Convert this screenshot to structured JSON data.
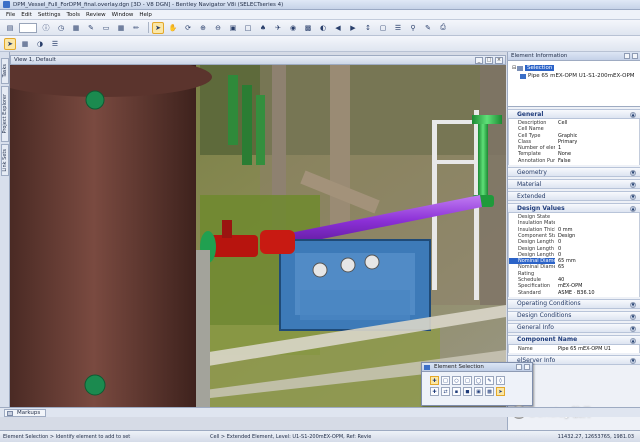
{
  "window": {
    "title": "DPM_Vessel_Full_ForDPM_final.overlay.dgn [3D - V8 DGN] - Bentley Navigator V8i (SELECTseries 4)"
  },
  "menu": [
    "File",
    "Edit",
    "Settings",
    "Tools",
    "Review",
    "Window",
    "Help"
  ],
  "left_tabs": [
    "Tasks",
    "Project Explorer",
    "Link Sets"
  ],
  "view": {
    "title": "View 1, Default"
  },
  "panel": {
    "title": "Element Information",
    "tree": {
      "root": "Selection",
      "child": "Pipe 65 mEX-OPM U1-S1-200mEX-OPM"
    },
    "general": {
      "title": "General",
      "rows": [
        {
          "label": "Description",
          "value": "Cell"
        },
        {
          "label": "Cell Name",
          "value": ""
        },
        {
          "label": "Cell Type",
          "value": "Graphic"
        },
        {
          "label": "Class",
          "value": "Primary"
        },
        {
          "label": "Number of elements",
          "value": "1"
        },
        {
          "label": "Template",
          "value": "None"
        },
        {
          "label": "Annotation Purpose",
          "value": "False"
        }
      ]
    },
    "collapsed_mid": [
      "Geometry",
      "Material",
      "Extended"
    ],
    "design": {
      "title": "Design Values",
      "rows": [
        {
          "label": "Design State",
          "value": ""
        },
        {
          "label": "Insulation Materia",
          "value": ""
        },
        {
          "label": "Insulation Thickn",
          "value": "0 mm"
        },
        {
          "label": "Component State",
          "value": "Design"
        },
        {
          "label": "Design Length Ce",
          "value": "0"
        },
        {
          "label": "Design Length Ce",
          "value": "0"
        },
        {
          "label": "Design Length Ce",
          "value": "0"
        },
        {
          "label": "Nominal Diamete",
          "value": "65 mm",
          "highlight": true
        },
        {
          "label": "Nominal Diamete",
          "value": "65"
        },
        {
          "label": "Rating",
          "value": ""
        },
        {
          "label": "Schedule",
          "value": "40"
        },
        {
          "label": "Specification",
          "value": "mEX-OPM"
        },
        {
          "label": "Standard",
          "value": "ASME · B36.10"
        }
      ]
    },
    "collapsed_bottom": [
      "Operating Conditions",
      "Design Conditions",
      "General Info"
    ],
    "component": {
      "title": "Component Name",
      "row": {
        "label": "Name",
        "value": "Pipe 65 mEX-OPM U1"
      }
    },
    "last_section": "elServer Info"
  },
  "element_selection": {
    "title": "Element Selection"
  },
  "markups": {
    "tab": "Markups"
  },
  "status": {
    "left": "Element Selection > Identify element to add to set",
    "mid": "Cell > Extended Element, Level: U1-S1-200mEX-OPM, Ref: Revie",
    "right": "11432.27, 12653765, 1981.03"
  },
  "watermark": "Bentley软件",
  "colors": {
    "pipe_purple": "#8b2fd6",
    "pipe_green": "#2fb24a",
    "valve_red": "#b7140e",
    "frame_blue": "#3d7ab8",
    "selection_blue": "#2b63c8"
  }
}
